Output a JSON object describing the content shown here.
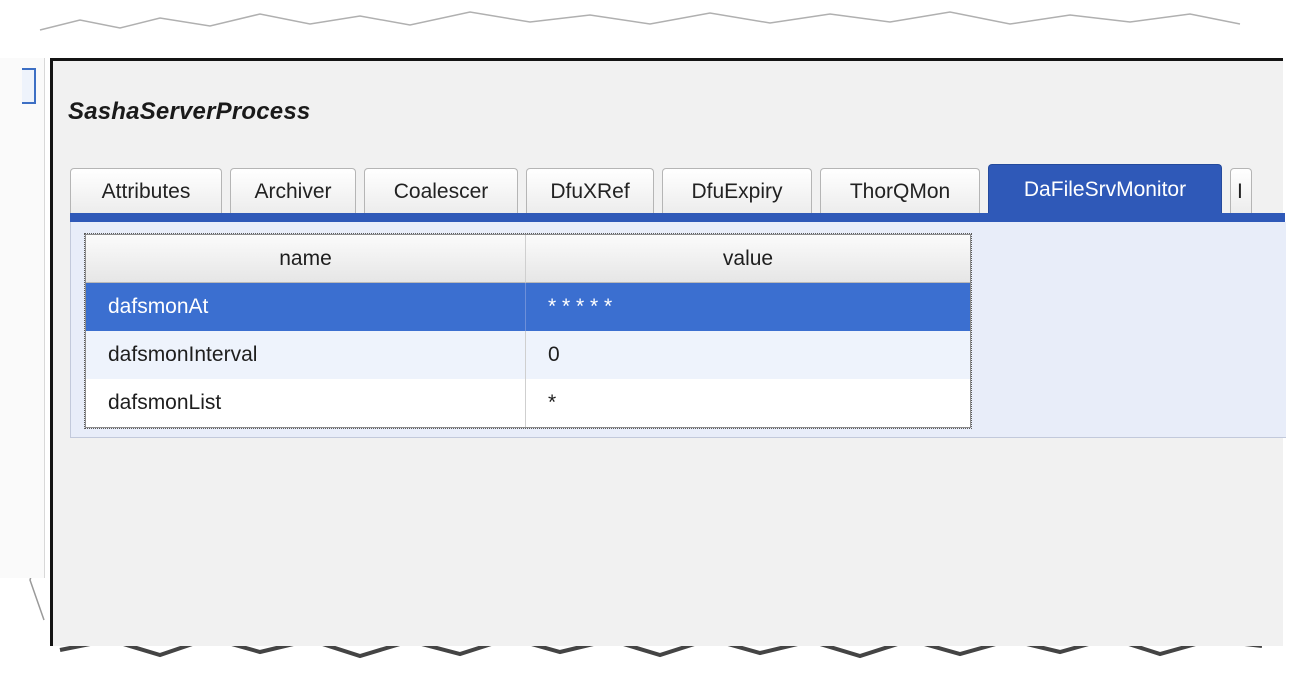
{
  "panel": {
    "title": "SashaServerProcess"
  },
  "tabs": [
    {
      "label": "Attributes"
    },
    {
      "label": "Archiver"
    },
    {
      "label": "Coalescer"
    },
    {
      "label": "DfuXRef"
    },
    {
      "label": "DfuExpiry"
    },
    {
      "label": "ThorQMon"
    },
    {
      "label": "DaFileSrvMonitor",
      "active": true
    },
    {
      "label": "I"
    }
  ],
  "grid": {
    "columns": [
      "name",
      "value"
    ],
    "rows": [
      {
        "name": "dafsmonAt",
        "value": "* * * * *",
        "selected": true
      },
      {
        "name": "dafsmonInterval",
        "value": "0"
      },
      {
        "name": "dafsmonList",
        "value": "*"
      }
    ]
  },
  "colors": {
    "accent": "#2f59b8",
    "selection": "#3b6fd0"
  }
}
